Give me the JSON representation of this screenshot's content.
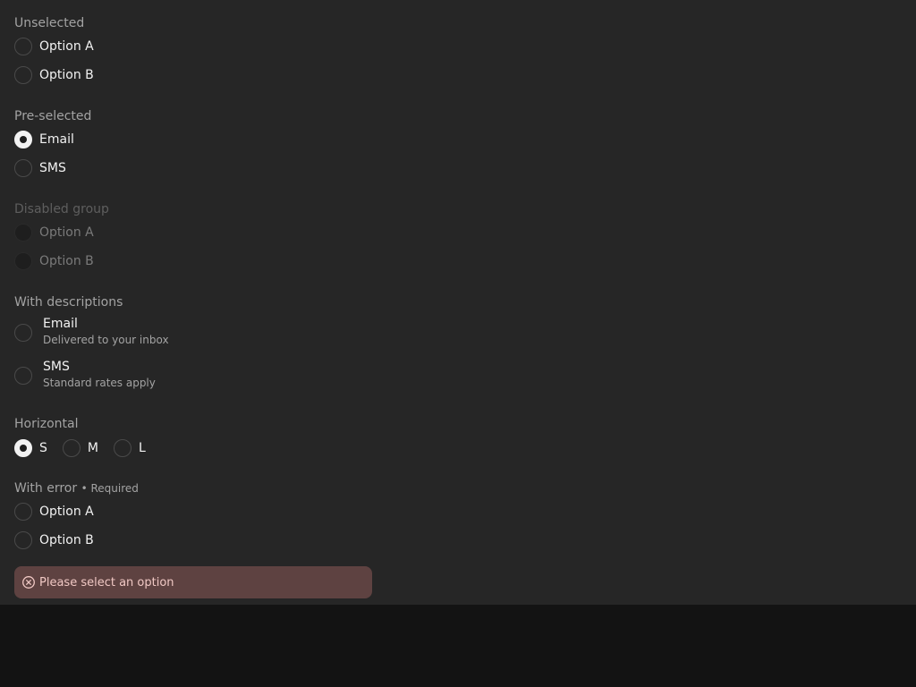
{
  "groups": {
    "unselected": {
      "legend": "Unselected",
      "options": [
        "Option A",
        "Option B"
      ]
    },
    "preselected": {
      "legend": "Pre-selected",
      "options": [
        "Email",
        "SMS"
      ],
      "selected": "Email"
    },
    "disabled": {
      "legend": "Disabled group",
      "options": [
        "Option A",
        "Option B"
      ]
    },
    "descriptions": {
      "legend": "With descriptions",
      "options": [
        {
          "title": "Email",
          "description": "Delivered to your inbox"
        },
        {
          "title": "SMS",
          "description": "Standard rates apply"
        }
      ]
    },
    "horizontal": {
      "legend": "Horizontal",
      "options": [
        "S",
        "M",
        "L"
      ],
      "selected": "S"
    },
    "error": {
      "legend": "With error",
      "required": "• Required",
      "options": [
        "Option A",
        "Option B"
      ],
      "message": "Please select an option"
    }
  },
  "icons": {
    "error_icon": "x-circle-icon"
  },
  "colors": {
    "panel_bg": "#262626",
    "page_bg": "#131313",
    "error_bg": "#5e4241",
    "error_text": "#f0c8c4",
    "checked_fill": "#f2f2f2"
  }
}
